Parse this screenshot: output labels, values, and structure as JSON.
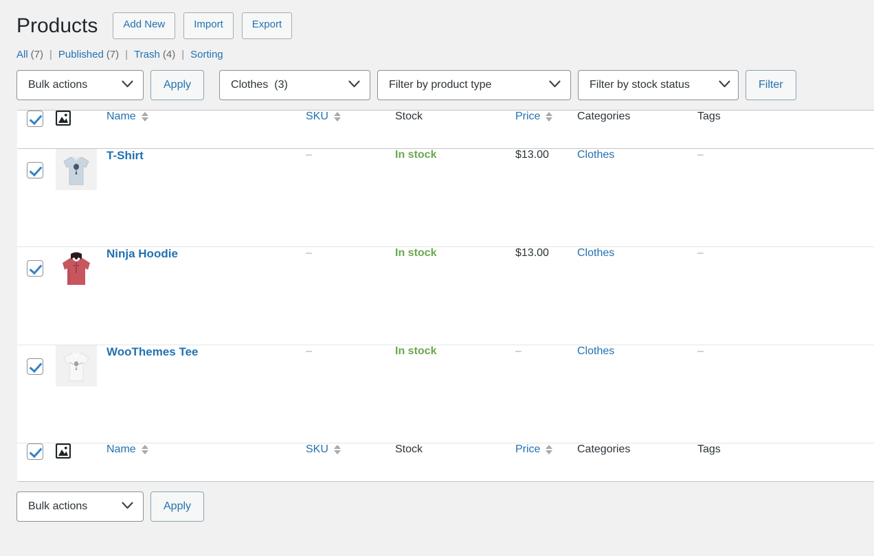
{
  "header": {
    "title": "Products",
    "actions": [
      {
        "label": "Add New",
        "name": "add-new-button"
      },
      {
        "label": "Import",
        "name": "import-button"
      },
      {
        "label": "Export",
        "name": "export-button"
      }
    ]
  },
  "views": [
    {
      "label": "All",
      "count": "(7)"
    },
    {
      "label": "Published",
      "count": "(7)"
    },
    {
      "label": "Trash",
      "count": "(4)"
    },
    {
      "label": "Sorting",
      "count": ""
    }
  ],
  "view_separator": "|",
  "tablenav_top": {
    "bulk_actions_label": "Bulk actions",
    "apply_label": "Apply",
    "category_label": "Clothes",
    "category_count": "(3)",
    "product_type_label": "Filter by product type",
    "stock_status_label": "Filter by stock status",
    "filter_label": "Filter"
  },
  "tablenav_bottom": {
    "bulk_actions_label": "Bulk actions",
    "apply_label": "Apply"
  },
  "table": {
    "columns": {
      "cb": "select-all",
      "thumb": "image",
      "name": "Name",
      "sku": "SKU",
      "stock": "Stock",
      "price": "Price",
      "categories": "Categories",
      "tags": "Tags"
    },
    "rows": [
      {
        "checked": true,
        "name": "T-Shirt",
        "thumb": "tshirt-blue",
        "sku": "–",
        "stock": "In stock",
        "price": "$13.00",
        "categories": "Clothes",
        "tags": "–"
      },
      {
        "checked": true,
        "name": "Ninja Hoodie",
        "thumb": "hoodie-red",
        "sku": "–",
        "stock": "In stock",
        "price": "$13.00",
        "categories": "Clothes",
        "tags": "–"
      },
      {
        "checked": true,
        "name": "WooThemes Tee",
        "thumb": "tshirt-white",
        "sku": "–",
        "stock": "In stock",
        "price": "–",
        "categories": "Clothes",
        "tags": "–"
      }
    ]
  },
  "colors": {
    "link": "#2271b1",
    "in_stock": "#6aa84f",
    "text": "#2c3338",
    "muted": "#a7aaad",
    "page_bg": "#f1f1f1"
  }
}
